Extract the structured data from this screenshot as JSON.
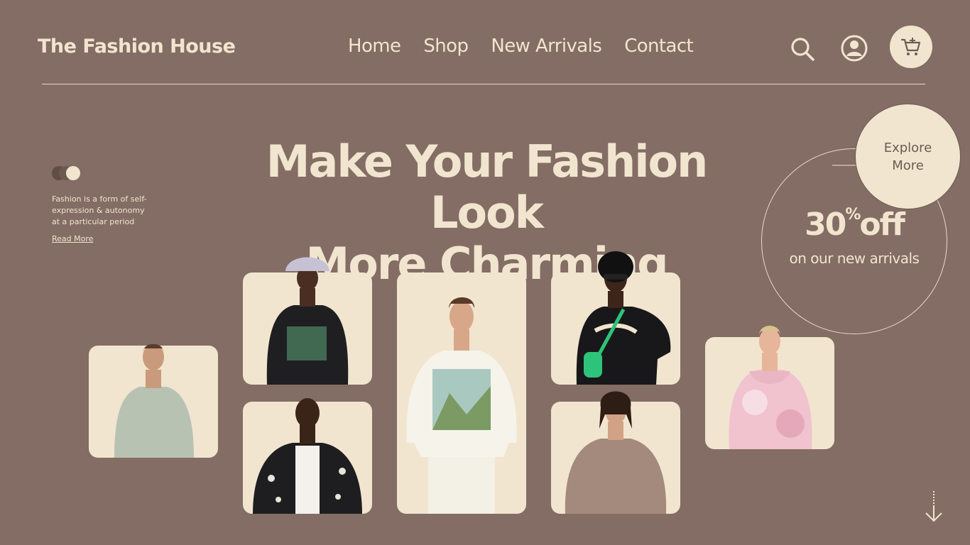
{
  "brand": "The Fashion House",
  "nav": {
    "items": [
      {
        "label": "Home"
      },
      {
        "label": "Shop"
      },
      {
        "label": "New Arrivals"
      },
      {
        "label": "Contact"
      }
    ]
  },
  "header_icons": [
    "search-icon",
    "account-icon",
    "cart-add-icon"
  ],
  "hero": {
    "headline_line1": "Make Your Fashion Look",
    "headline_line2": "More Charming",
    "blurb": "Fashion is a form of self-expression & autonomy at a particular period",
    "read_more": "Read More"
  },
  "promo": {
    "percent": "30",
    "percent_sign": "%",
    "off": "off",
    "subtitle": "on our new arrivals"
  },
  "explore": {
    "line1": "Explore",
    "line2": "More"
  },
  "products": [
    {
      "name": "sage sweatshirt model",
      "color": "#b7c2b3"
    },
    {
      "name": "black graphic sweatshirt model",
      "color": "#1f1f22"
    },
    {
      "name": "black printed shirt model",
      "color": "#1e1e20"
    },
    {
      "name": "white art sweatshirt model",
      "color": "#f6f3ea"
    },
    {
      "name": "black varsity sweatshirt model",
      "color": "#18181a"
    },
    {
      "name": "taupe sweatshirt model",
      "color": "#a38a7c"
    },
    {
      "name": "pink tie-dye hoodie model",
      "color": "#f0c3cf"
    }
  ],
  "colors": {
    "background": "#846d64",
    "cream": "#f1e5cf",
    "text_dark": "#6e5b54"
  }
}
